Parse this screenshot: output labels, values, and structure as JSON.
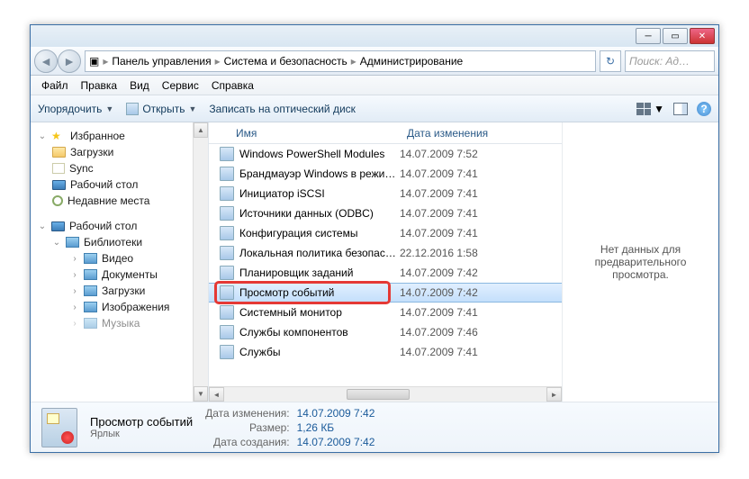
{
  "breadcrumb": {
    "p1": "Панель управления",
    "p2": "Система и безопасность",
    "p3": "Администрирование"
  },
  "search": {
    "placeholder": "Поиск: Ад…"
  },
  "menu": {
    "file": "Файл",
    "edit": "Правка",
    "view": "Вид",
    "tools": "Сервис",
    "help": "Справка"
  },
  "toolbar": {
    "organize": "Упорядочить",
    "open": "Открыть",
    "burn": "Записать на оптический диск"
  },
  "columns": {
    "name": "Имя",
    "date": "Дата изменения"
  },
  "sidebar": {
    "favorites": "Избранное",
    "downloads": "Загрузки",
    "sync": "Sync",
    "desktop": "Рабочий стол",
    "recent": "Недавние места",
    "desktop2": "Рабочий стол",
    "libraries": "Библиотеки",
    "video": "Видео",
    "documents": "Документы",
    "downloads2": "Загрузки",
    "pictures": "Изображения",
    "music": "Музыка"
  },
  "files": [
    {
      "name": "Windows PowerShell Modules",
      "date": "14.07.2009 7:52"
    },
    {
      "name": "Брандмауэр Windows в режиме повы...",
      "date": "14.07.2009 7:41"
    },
    {
      "name": "Инициатор iSCSI",
      "date": "14.07.2009 7:41"
    },
    {
      "name": "Источники данных (ODBC)",
      "date": "14.07.2009 7:41"
    },
    {
      "name": "Конфигурация системы",
      "date": "14.07.2009 7:41"
    },
    {
      "name": "Локальная политика безопасности",
      "date": "22.12.2016 1:58"
    },
    {
      "name": "Планировщик заданий",
      "date": "14.07.2009 7:42"
    },
    {
      "name": "Просмотр событий",
      "date": "14.07.2009 7:42"
    },
    {
      "name": "Системный монитор",
      "date": "14.07.2009 7:41"
    },
    {
      "name": "Службы компонентов",
      "date": "14.07.2009 7:46"
    },
    {
      "name": "Службы",
      "date": "14.07.2009 7:41"
    }
  ],
  "preview": {
    "empty": "Нет данных для предварительного просмотра."
  },
  "details": {
    "title": "Просмотр событий",
    "type": "Ярлык",
    "k_modified": "Дата изменения:",
    "v_modified": "14.07.2009 7:42",
    "k_size": "Размер:",
    "v_size": "1,26 КБ",
    "k_created": "Дата создания:",
    "v_created": "14.07.2009 7:42"
  }
}
